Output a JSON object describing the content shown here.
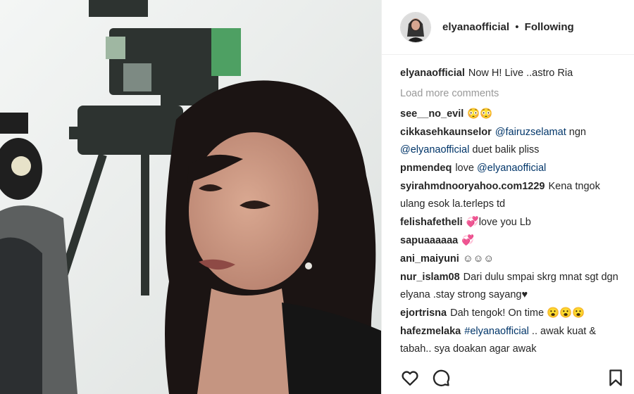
{
  "post_header": {
    "username": "elyanaofficial",
    "separator": "•",
    "follow_status": "Following"
  },
  "caption": {
    "username": "elyanaofficial",
    "text": "Now H! Live ..astro Ria"
  },
  "load_more_label": "Load more comments",
  "comments": [
    {
      "username": "see__no_evil",
      "parts": [
        {
          "text": "😳😳"
        }
      ]
    },
    {
      "username": "cikkasehkaunselor",
      "parts": [
        {
          "text": "@fairuzselamat",
          "mention": true
        },
        {
          "text": " ngn "
        },
        {
          "text": "@elyanaofficial",
          "mention": true
        },
        {
          "text": " duet balik pliss"
        }
      ]
    },
    {
      "username": "pnmendeq",
      "parts": [
        {
          "text": "love "
        },
        {
          "text": "@elyanaofficial",
          "mention": true
        }
      ]
    },
    {
      "username": "syirahmdnooryahoo.com1229",
      "parts": [
        {
          "text": "Kena tngok ulang esok la.terleps td"
        }
      ]
    },
    {
      "username": "felishafetheli",
      "parts": [
        {
          "text": "💞love you Lb"
        }
      ]
    },
    {
      "username": "sapuaaaaaa",
      "parts": [
        {
          "text": "💞"
        }
      ]
    },
    {
      "username": "ani_maiyuni",
      "parts": [
        {
          "text": "☺☺☺"
        }
      ]
    },
    {
      "username": "nur_islam08",
      "parts": [
        {
          "text": "Dari dulu smpai skrg mnat sgt dgn elyana .stay strong sayang♥"
        }
      ]
    },
    {
      "username": "ejortrisna",
      "parts": [
        {
          "text": "Dah tengok! On time 😮😮😮"
        }
      ]
    },
    {
      "username": "hafezmelaka",
      "parts": [
        {
          "text": "#elyanaofficial",
          "mention": true
        },
        {
          "text": " .. awak kuat & tabah.. sya doakan agar awak"
        }
      ]
    }
  ],
  "icons": {
    "like": "heart-icon",
    "comment": "comment-icon",
    "save": "bookmark-icon"
  }
}
